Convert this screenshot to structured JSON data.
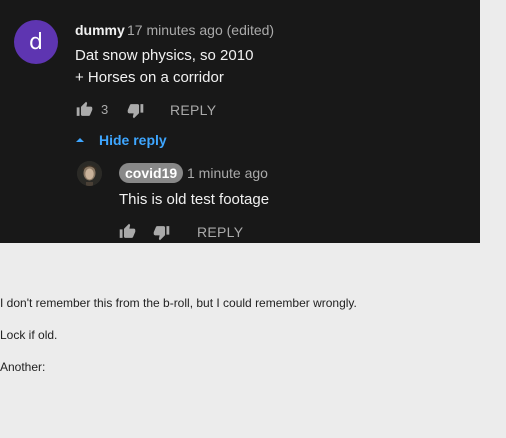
{
  "comment": {
    "avatar_letter": "d",
    "author": "dummy",
    "meta": "17 minutes ago (edited)",
    "text_line1": "Dat snow physics, so 2010",
    "text_line2": "+ Horses on a corridor",
    "like_count": "3",
    "reply_label": "REPLY",
    "hide_reply_label": "Hide reply"
  },
  "reply": {
    "author": "covid19",
    "meta": "1 minute ago",
    "text": "This is old test footage",
    "reply_label": "REPLY"
  },
  "page_text": {
    "line1": "I don't remember this from the b-roll, but I could remember wrongly.",
    "line2": "Lock if old.",
    "line3": "Another:"
  },
  "colors": {
    "panel_bg": "#181818",
    "avatar_bg": "#5e35b1",
    "link": "#3ea6ff",
    "page_bg": "#ececec"
  },
  "icons": [
    "thumbs-up-icon",
    "thumbs-down-icon",
    "caret-up-icon",
    "avatar-image-icon"
  ]
}
